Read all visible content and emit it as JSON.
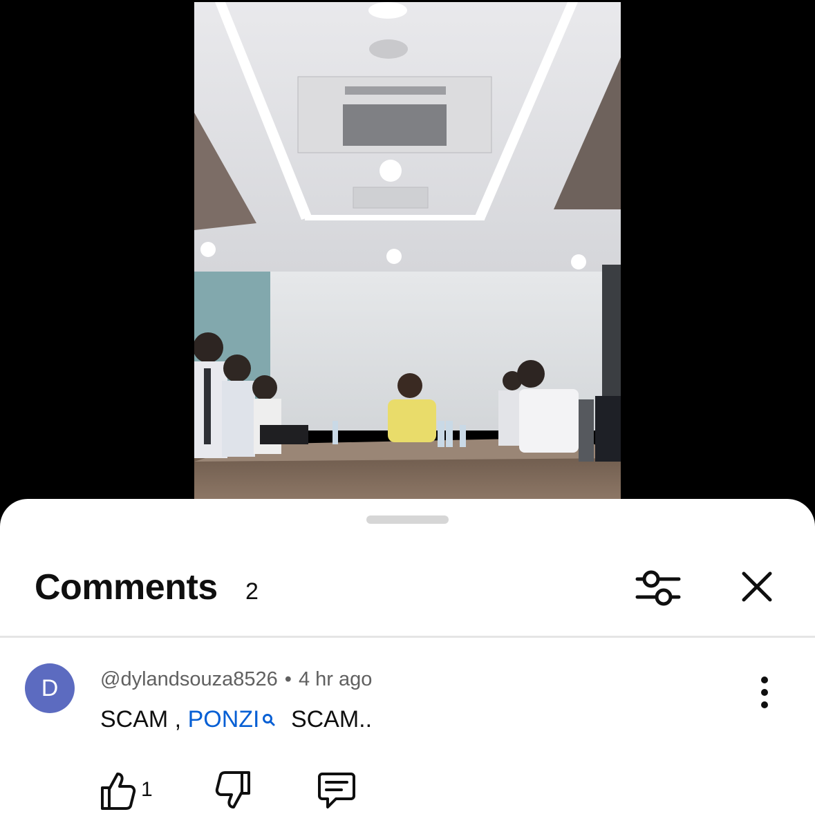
{
  "video": {
    "thumbnail_icon": "conference-room-video-frame"
  },
  "comments_panel": {
    "title": "Comments",
    "count": "2",
    "filter_icon": "sliders-icon",
    "close_icon": "close-icon"
  },
  "comment": {
    "avatar_letter": "D",
    "avatar_color": "#5c6bc0",
    "author": "@dylandsouza8526",
    "separator": "•",
    "time": "4 hr ago",
    "text_part1": "SCAM ,",
    "link_text": "PONZI",
    "text_part2": "SCAM..",
    "link_color": "#065fd4",
    "like_count": "1"
  }
}
